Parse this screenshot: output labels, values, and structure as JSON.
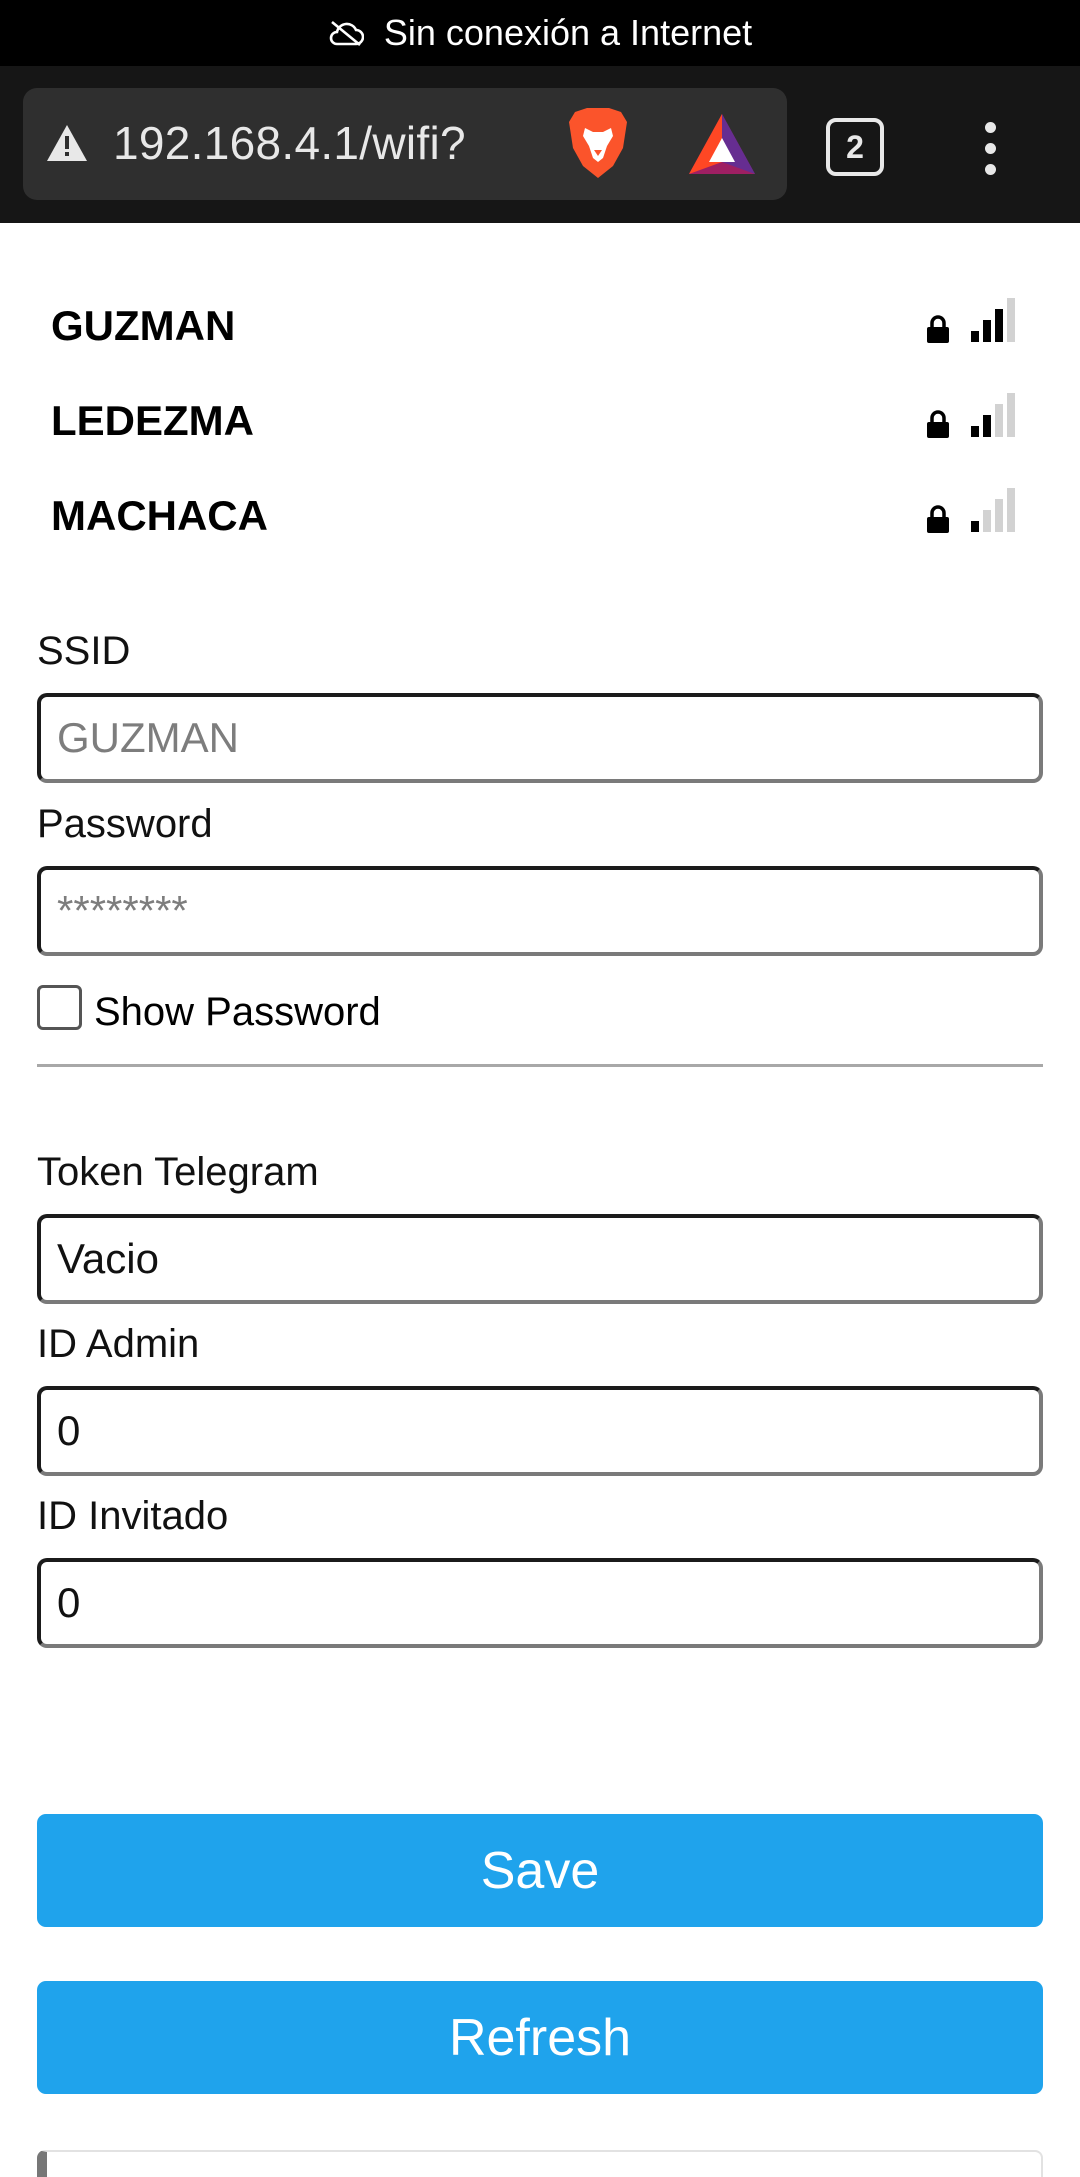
{
  "status_bar": {
    "text": "Sin conexión a Internet"
  },
  "browser": {
    "url": "192.168.4.1/wifi?",
    "tab_count": "2"
  },
  "networks": [
    {
      "name": "GUZMAN",
      "signal_bars": 3
    },
    {
      "name": "LEDEZMA",
      "signal_bars": 2
    },
    {
      "name": "MACHACA",
      "signal_bars": 1
    }
  ],
  "form": {
    "ssid_label": "SSID",
    "ssid_placeholder": "GUZMAN",
    "password_label": "Password",
    "password_placeholder": "********",
    "show_password_label": "Show Password",
    "token_label": "Token Telegram",
    "token_value": "Vacio",
    "admin_label": "ID Admin",
    "admin_value": "0",
    "guest_label": "ID Invitado",
    "guest_value": "0"
  },
  "buttons": {
    "save": "Save",
    "refresh": "Refresh"
  },
  "colors": {
    "button_bg": "#1fa3ec",
    "signal_active": "#000000",
    "signal_inactive": "#d2d2d2"
  }
}
